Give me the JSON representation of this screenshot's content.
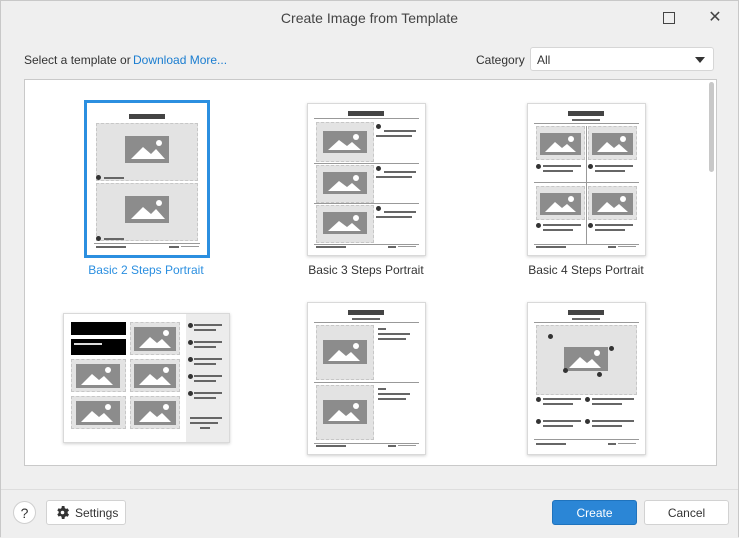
{
  "window": {
    "title": "Create Image from Template",
    "maximize_icon": "maximize-icon",
    "close_icon": "close-icon"
  },
  "header": {
    "prompt_text": "Select a template or",
    "download_link": "Download More...",
    "category_label": "Category",
    "category_value": "All"
  },
  "templates": [
    {
      "label": "Basic 2 Steps Portrait",
      "selected": true
    },
    {
      "label": "Basic 3 Steps Portrait",
      "selected": false
    },
    {
      "label": "Basic 4 Steps Portrait",
      "selected": false
    },
    {
      "label": "",
      "selected": false
    },
    {
      "label": "",
      "selected": false
    },
    {
      "label": "",
      "selected": false
    }
  ],
  "footer": {
    "help_label": "?",
    "settings_label": "Settings",
    "create_label": "Create",
    "cancel_label": "Cancel"
  },
  "colors": {
    "accent": "#2b86d6",
    "selected_border": "#2b8fe0"
  }
}
